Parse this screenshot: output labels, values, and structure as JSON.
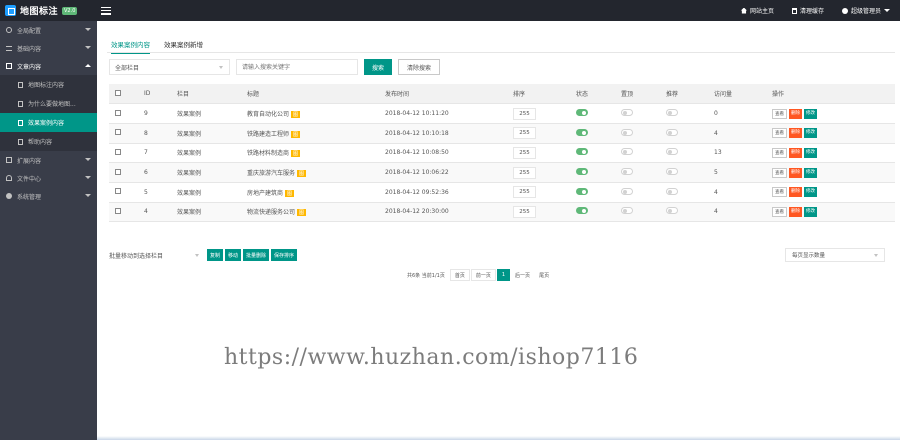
{
  "app": {
    "title": "地图标注",
    "version": "V2.0",
    "accent": "#009688"
  },
  "topnav": {
    "site_home": "网站主页",
    "clear_cache": "清理缓存",
    "admin": "超级管理员"
  },
  "sidebar": {
    "items": [
      {
        "label": "全局配置",
        "icon": "gear-icon"
      },
      {
        "label": "基础内容",
        "icon": "list-icon"
      },
      {
        "label": "文章内容",
        "icon": "doc-icon",
        "open": true
      },
      {
        "label": "扩展内容",
        "icon": "extend-icon"
      },
      {
        "label": "文件中心",
        "icon": "person-icon"
      },
      {
        "label": "系统管理",
        "icon": "system-icon"
      }
    ],
    "sub_items": [
      {
        "label": "地图标注内容"
      },
      {
        "label": "为什么要做地图..."
      },
      {
        "label": "效果案例内容",
        "active": true
      },
      {
        "label": "帮助内容"
      }
    ]
  },
  "tabs": [
    "效果案例内容",
    "效果案例新增"
  ],
  "filter": {
    "category_select": "全部栏目",
    "search_placeholder": "请输入搜索关键字",
    "search_button": "搜索",
    "clear_button": "清除搜索"
  },
  "table": {
    "headers": [
      "",
      "ID",
      "栏目",
      "标题",
      "发布时间",
      "排序",
      "状态",
      "置顶",
      "推荐",
      "访问量",
      "操作"
    ],
    "badge": "图",
    "rows": [
      {
        "id": "9",
        "category": "效果案例",
        "title": "教育自动化公司",
        "time": "2018-04-12 10:11:20",
        "sort": "255",
        "status": true,
        "top": false,
        "rec": false,
        "views": "0"
      },
      {
        "id": "8",
        "category": "效果案例",
        "title": "铁路建造工程师",
        "time": "2018-04-12 10:10:18",
        "sort": "255",
        "status": true,
        "top": false,
        "rec": false,
        "views": "4"
      },
      {
        "id": "7",
        "category": "效果案例",
        "title": "铁路材料制造商",
        "time": "2018-04-12 10:08:50",
        "sort": "255",
        "status": true,
        "top": false,
        "rec": false,
        "views": "13"
      },
      {
        "id": "6",
        "category": "效果案例",
        "title": "重庆旅游汽车服务",
        "time": "2018-04-12 10:06:22",
        "sort": "255",
        "status": true,
        "top": false,
        "rec": false,
        "views": "5"
      },
      {
        "id": "5",
        "category": "效果案例",
        "title": "房地产建筑商",
        "time": "2018-04-12 09:52:36",
        "sort": "255",
        "status": true,
        "top": false,
        "rec": false,
        "views": "4"
      },
      {
        "id": "4",
        "category": "效果案例",
        "title": "物流快递服务公司",
        "time": "2018-04-12 20:30:00",
        "sort": "255",
        "status": true,
        "top": false,
        "rec": false,
        "views": "4"
      }
    ],
    "ops": {
      "view": "查看",
      "del": "删除",
      "edit": "修改"
    }
  },
  "bulk": {
    "move_select": "批量移动到选择栏目",
    "buttons": [
      "复制",
      "移动",
      "批量删除",
      "保存排序"
    ]
  },
  "per_page": "每页显示数量",
  "pager": {
    "summary": "共6条 当前1/1页",
    "first": "首页",
    "prev": "前一页",
    "current": "1",
    "next": "后一页",
    "last": "尾页"
  },
  "watermark": "https://www.huzhan.com/ishop7116"
}
